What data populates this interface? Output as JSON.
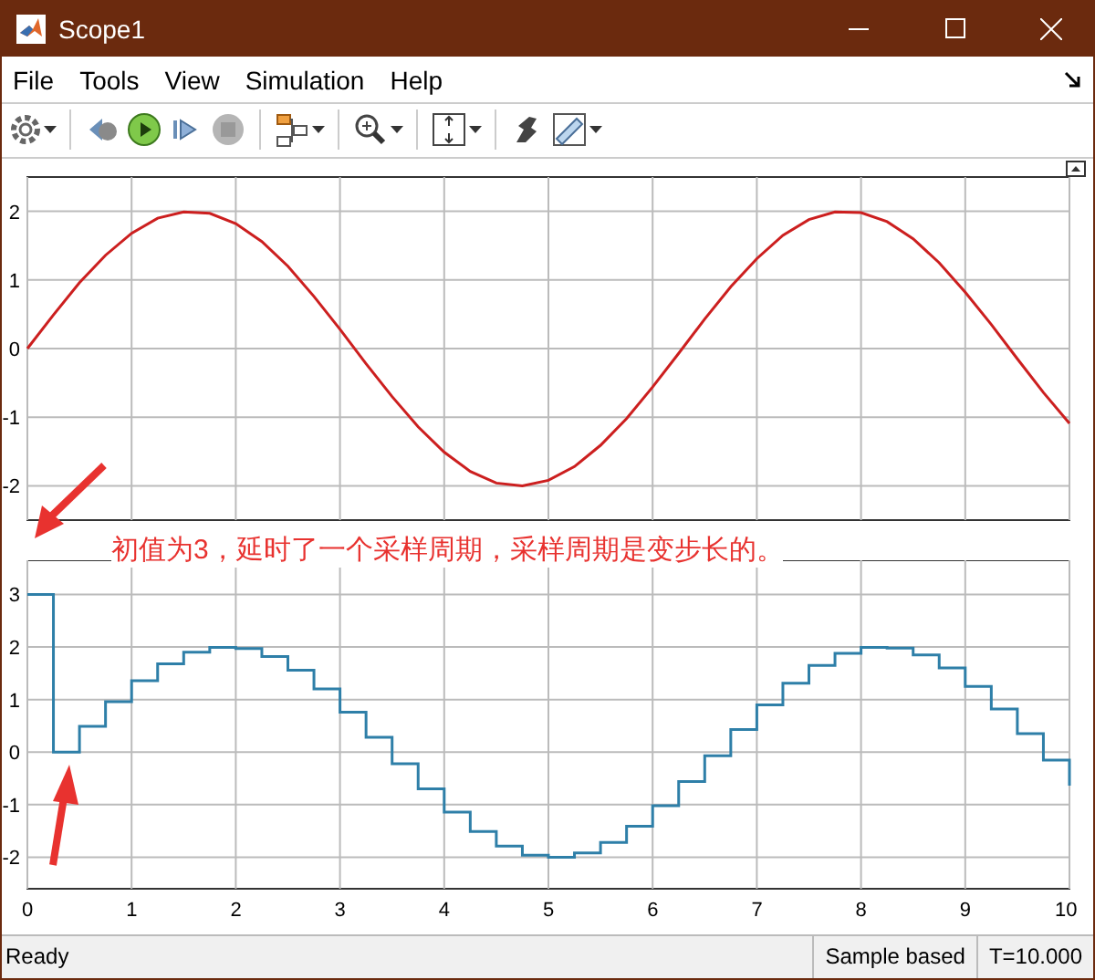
{
  "window": {
    "title": "Scope1"
  },
  "menu": [
    {
      "label": "File"
    },
    {
      "label": "Tools"
    },
    {
      "label": "View"
    },
    {
      "label": "Simulation"
    },
    {
      "label": "Help"
    }
  ],
  "plots": [
    {
      "chart_data": {
        "type": "line",
        "grid": true,
        "x": [
          0,
          0.25,
          0.5,
          0.75,
          1,
          1.25,
          1.5,
          1.75,
          2,
          2.25,
          2.5,
          2.75,
          3,
          3.25,
          3.5,
          3.75,
          4,
          4.25,
          4.5,
          4.75,
          5,
          5.25,
          5.5,
          5.75,
          6,
          6.25,
          6.5,
          6.75,
          7,
          7.25,
          7.5,
          7.75,
          8,
          8.25,
          8.5,
          8.75,
          9,
          9.25,
          9.5,
          9.75,
          10
        ],
        "xlim": [
          0,
          10
        ],
        "ylim": [
          -2.5,
          2.5
        ],
        "yticks": [
          -2,
          -1,
          0,
          1,
          2
        ],
        "series": [
          {
            "color": "#cc1f1f",
            "values": [
              0,
              0.49,
              0.96,
              1.36,
              1.68,
              1.9,
              1.99,
              1.97,
              1.82,
              1.56,
              1.2,
              0.76,
              0.28,
              -0.22,
              -0.7,
              -1.14,
              -1.51,
              -1.79,
              -1.96,
              -2,
              -1.92,
              -1.72,
              -1.41,
              -1.02,
              -0.56,
              -0.07,
              0.43,
              0.9,
              1.31,
              1.65,
              1.88,
              1.99,
              1.98,
              1.85,
              1.6,
              1.25,
              0.82,
              0.35,
              -0.15,
              -0.64,
              -1.09
            ]
          }
        ]
      }
    },
    {
      "chart_data": {
        "type": "line",
        "grid": true,
        "x": [
          0,
          0.25,
          0.25,
          0.5,
          0.5,
          0.75,
          0.75,
          1,
          1,
          1.25,
          1.25,
          1.5,
          1.5,
          1.75,
          1.75,
          2,
          2,
          2.25,
          2.25,
          2.5,
          2.5,
          2.75,
          2.75,
          3,
          3,
          3.25,
          3.25,
          3.5,
          3.5,
          3.75,
          3.75,
          4,
          4,
          4.25,
          4.25,
          4.5,
          4.5,
          4.75,
          4.75,
          5,
          5,
          5.25,
          5.25,
          5.5,
          5.5,
          5.75,
          5.75,
          6,
          6,
          6.25,
          6.25,
          6.5,
          6.5,
          6.75,
          6.75,
          7,
          7,
          7.25,
          7.25,
          7.5,
          7.5,
          7.75,
          7.75,
          8,
          8,
          8.25,
          8.25,
          8.5,
          8.5,
          8.75,
          8.75,
          9,
          9,
          9.25,
          9.25,
          9.5,
          9.5,
          9.75,
          9.75,
          10,
          10
        ],
        "xlim": [
          0,
          10
        ],
        "ylim": [
          -2.6,
          3.65
        ],
        "xticks": [
          0,
          1,
          2,
          3,
          4,
          5,
          6,
          7,
          8,
          9,
          10
        ],
        "yticks": [
          -2,
          -1,
          0,
          1,
          2,
          3
        ],
        "series": [
          {
            "color": "#2e7fa8",
            "values": [
              3,
              3,
              0,
              0,
              0.49,
              0.49,
              0.96,
              0.96,
              1.36,
              1.36,
              1.68,
              1.68,
              1.9,
              1.9,
              1.99,
              1.99,
              1.97,
              1.97,
              1.82,
              1.82,
              1.56,
              1.56,
              1.2,
              1.2,
              0.76,
              0.76,
              0.28,
              0.28,
              -0.22,
              -0.22,
              -0.7,
              -0.7,
              -1.14,
              -1.14,
              -1.51,
              -1.51,
              -1.79,
              -1.79,
              -1.96,
              -1.96,
              -2,
              -2,
              -1.92,
              -1.92,
              -1.72,
              -1.72,
              -1.41,
              -1.41,
              -1.02,
              -1.02,
              -0.56,
              -0.56,
              -0.07,
              -0.07,
              0.43,
              0.43,
              0.9,
              0.9,
              1.31,
              1.31,
              1.65,
              1.65,
              1.88,
              1.88,
              1.99,
              1.99,
              1.98,
              1.98,
              1.85,
              1.85,
              1.6,
              1.6,
              1.25,
              1.25,
              0.82,
              0.82,
              0.35,
              0.35,
              -0.15,
              -0.15,
              -0.64
            ]
          }
        ]
      }
    }
  ],
  "annotation": {
    "text": "初值为3，延时了一个采样周期，采样周期是变步长的。"
  },
  "status_bar": {
    "status": "Ready",
    "mode": "Sample based",
    "time": "T=10.000"
  }
}
